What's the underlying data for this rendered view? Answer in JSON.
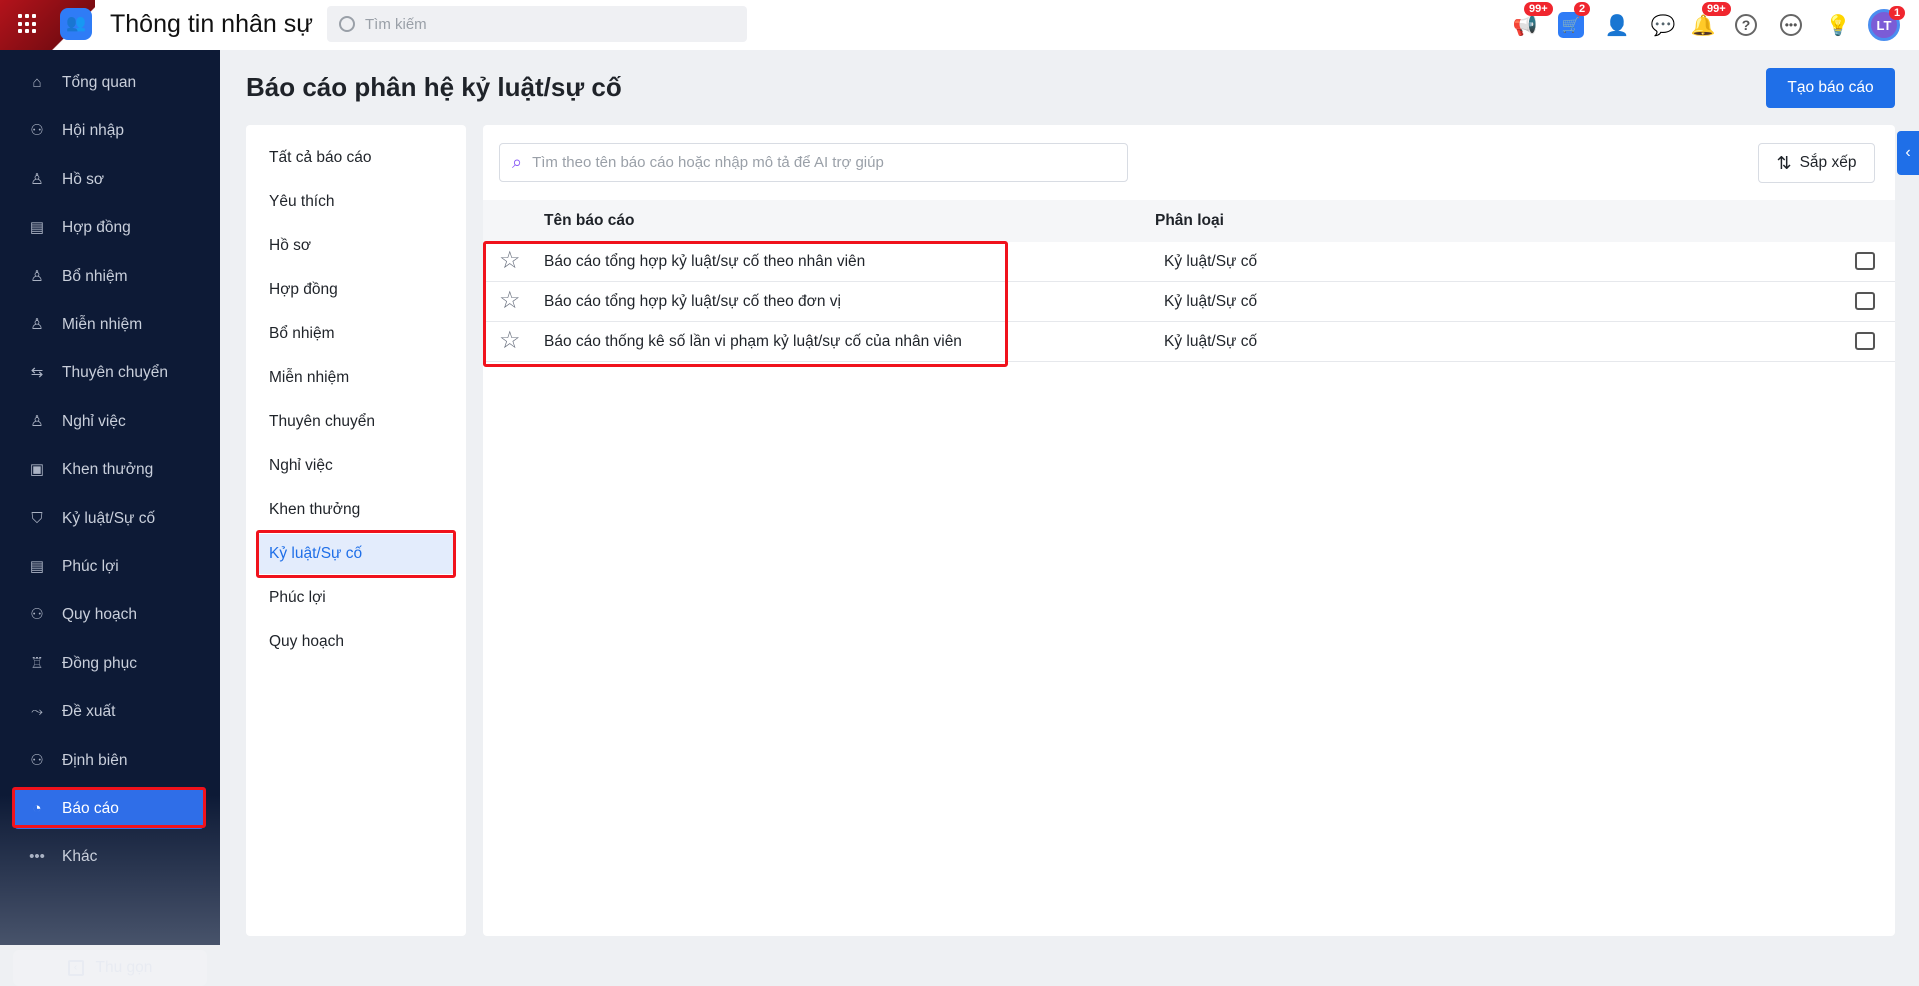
{
  "header": {
    "app_title": "Thông tin nhân sự",
    "search_placeholder": "Tìm kiếm",
    "badges": {
      "announcements": "99+",
      "cart": "2",
      "notifications": "99+",
      "avatar": "1"
    },
    "avatar_initials": "LT"
  },
  "sidebar": {
    "items": [
      {
        "label": "Tổng quan",
        "icon": "⌂"
      },
      {
        "label": "Hội nhập",
        "icon": "⚇"
      },
      {
        "label": "Hồ sơ",
        "icon": "♙"
      },
      {
        "label": "Hợp đồng",
        "icon": "▤"
      },
      {
        "label": "Bổ nhiệm",
        "icon": "♙"
      },
      {
        "label": "Miễn nhiệm",
        "icon": "♙"
      },
      {
        "label": "Thuyên chuyển",
        "icon": "⇆"
      },
      {
        "label": "Nghỉ việc",
        "icon": "♙"
      },
      {
        "label": "Khen thưởng",
        "icon": "▣"
      },
      {
        "label": "Kỷ luật/Sự cố",
        "icon": "⛉"
      },
      {
        "label": "Phúc lợi",
        "icon": "▤"
      },
      {
        "label": "Quy hoạch",
        "icon": "⚇"
      },
      {
        "label": "Đồng phục",
        "icon": "♖"
      },
      {
        "label": "Đề xuất",
        "icon": "⤳"
      },
      {
        "label": "Định biên",
        "icon": "⚇"
      },
      {
        "label": "Báo cáo",
        "icon": "◔"
      },
      {
        "label": "Khác",
        "icon": "•••"
      }
    ],
    "collapse_label": "Thu gọn"
  },
  "page": {
    "title": "Báo cáo phân hệ kỷ luật/sự cố",
    "create_button": "Tạo báo cáo"
  },
  "filters": [
    "Tất cả báo cáo",
    "Yêu thích",
    "Hồ sơ",
    "Hợp đồng",
    "Bổ nhiệm",
    "Miễn nhiệm",
    "Thuyên chuyển",
    "Nghỉ việc",
    "Khen thưởng",
    "Kỷ luật/Sự cố",
    "Phúc lợi",
    "Quy hoạch"
  ],
  "main": {
    "search_placeholder": "Tìm theo tên báo cáo hoặc nhập mô tả để AI trợ giúp",
    "sort_label": "Sắp xếp",
    "columns": {
      "name": "Tên báo cáo",
      "category": "Phân loại"
    },
    "rows": [
      {
        "name": "Báo cáo tổng hợp kỷ luật/sự cố theo nhân viên",
        "category": "Kỷ luật/Sự cố"
      },
      {
        "name": "Báo cáo tổng hợp kỷ luật/sự cố theo đơn vị",
        "category": "Kỷ luật/Sự cố"
      },
      {
        "name": "Báo cáo thống kê số lần vi phạm kỷ luật/sự cố của nhân viên",
        "category": "Kỷ luật/Sự cố"
      }
    ]
  }
}
